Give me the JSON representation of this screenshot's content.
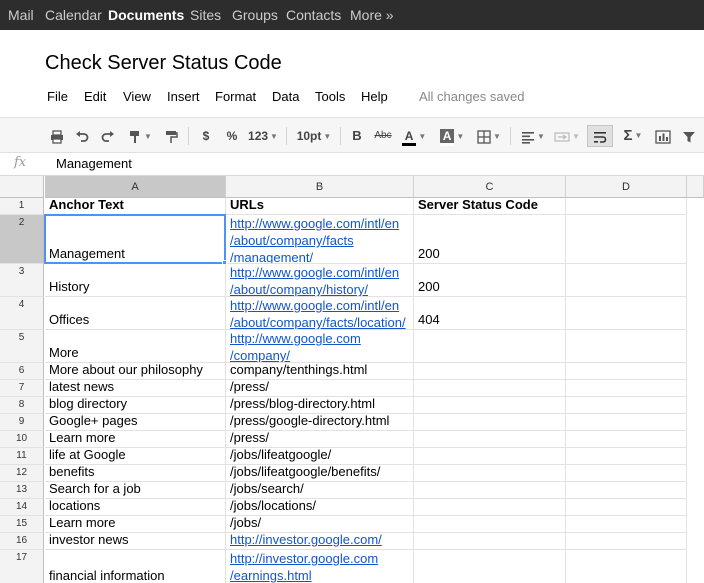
{
  "topbar": {
    "items": [
      "Mail",
      "Calendar",
      "Documents",
      "Sites",
      "Groups",
      "Contacts",
      "More »"
    ],
    "active": "Documents"
  },
  "doc": {
    "title": "Check Server Status Code",
    "menu": [
      "File",
      "Edit",
      "View",
      "Insert",
      "Format",
      "Data",
      "Tools",
      "Help"
    ],
    "save_status": "All changes saved"
  },
  "toolbar": {
    "currency": "$",
    "percent": "%",
    "number_format": "123",
    "font_size": "10pt",
    "bold": "B",
    "strike": "Abc",
    "text_color": "A",
    "fill_color": "A",
    "sum": "Σ",
    "icons": [
      "print-icon",
      "undo-icon",
      "redo-icon",
      "paint-format-icon",
      "borders-icon",
      "align-left-icon",
      "merge-icon",
      "wrap-text-icon",
      "chart-icon",
      "filter-icon"
    ]
  },
  "formula_bar": {
    "fx": "fx",
    "value": "Management"
  },
  "sheet": {
    "columns": [
      "A",
      "B",
      "C",
      "D"
    ],
    "selected_cell": "A2",
    "rows": [
      {
        "num": "1",
        "a": [
          "Anchor Text"
        ],
        "b": [
          "URLs"
        ],
        "b_link": false,
        "c": "Server Status Code",
        "header": true
      },
      {
        "num": "2",
        "a": [
          "Management"
        ],
        "b": [
          "http://www.google.com/intl/en",
          "/about/company/facts",
          "/management/"
        ],
        "b_link": true,
        "c": "200"
      },
      {
        "num": "3",
        "a": [
          "History"
        ],
        "b": [
          "http://www.google.com/intl/en",
          "/about/company/history/"
        ],
        "b_link": true,
        "c": "200"
      },
      {
        "num": "4",
        "a": [
          "Offices"
        ],
        "b": [
          "http://www.google.com/intl/en",
          "/about/company/facts/location/"
        ],
        "b_link": true,
        "c": "404"
      },
      {
        "num": "5",
        "a": [
          "More"
        ],
        "b": [
          "http://www.google.com",
          "/company/"
        ],
        "b_link": true,
        "c": ""
      },
      {
        "num": "6",
        "a": [
          "More about our philosophy"
        ],
        "b": [
          "company/tenthings.html"
        ],
        "b_link": false,
        "c": ""
      },
      {
        "num": "7",
        "a": [
          "latest news"
        ],
        "b": [
          "/press/"
        ],
        "b_link": false,
        "c": ""
      },
      {
        "num": "8",
        "a": [
          "blog directory"
        ],
        "b": [
          "/press/blog-directory.html"
        ],
        "b_link": false,
        "c": ""
      },
      {
        "num": "9",
        "a": [
          "Google+ pages"
        ],
        "b": [
          "/press/google-directory.html"
        ],
        "b_link": false,
        "c": ""
      },
      {
        "num": "10",
        "a": [
          "Learn more"
        ],
        "b": [
          "/press/"
        ],
        "b_link": false,
        "c": ""
      },
      {
        "num": "11",
        "a": [
          "life at Google"
        ],
        "b": [
          "/jobs/lifeatgoogle/"
        ],
        "b_link": false,
        "c": ""
      },
      {
        "num": "12",
        "a": [
          "benefits"
        ],
        "b": [
          "/jobs/lifeatgoogle/benefits/"
        ],
        "b_link": false,
        "c": ""
      },
      {
        "num": "13",
        "a": [
          "Search for a job"
        ],
        "b": [
          "/jobs/search/"
        ],
        "b_link": false,
        "c": ""
      },
      {
        "num": "14",
        "a": [
          "locations"
        ],
        "b": [
          "/jobs/locations/"
        ],
        "b_link": false,
        "c": ""
      },
      {
        "num": "15",
        "a": [
          "Learn more"
        ],
        "b": [
          "/jobs/"
        ],
        "b_link": false,
        "c": ""
      },
      {
        "num": "16",
        "a": [
          "investor news"
        ],
        "b": [
          "http://investor.google.com/"
        ],
        "b_link": true,
        "c": ""
      },
      {
        "num": "17",
        "a": [
          "financial information"
        ],
        "b": [
          "http://investor.google.com",
          "/earnings.html"
        ],
        "b_link": true,
        "c": ""
      }
    ]
  },
  "colors": {
    "topbar_bg": "#2d2d2d",
    "link": "#1155cc",
    "selection": "#4d90fe"
  }
}
